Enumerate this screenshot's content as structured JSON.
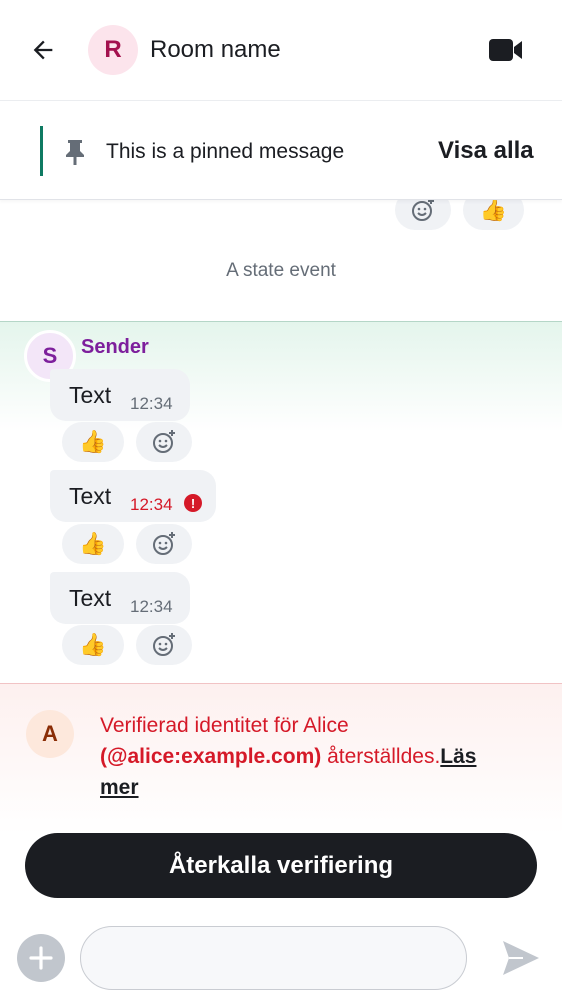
{
  "header": {
    "avatar_letter": "R",
    "room_name": "Room name"
  },
  "pinned": {
    "message": "This is a pinned message",
    "view_all": "Visa alla"
  },
  "top_reactions": [
    "👍"
  ],
  "state_event": "A state event",
  "group": {
    "avatar_letter": "S",
    "sender": "Sender",
    "messages": [
      {
        "text": "Text",
        "time": "12:34",
        "reaction": "👍",
        "failed": false
      },
      {
        "text": "Text",
        "time": "12:34",
        "reaction": "👍",
        "failed": true
      },
      {
        "text": "Text",
        "time": "12:34",
        "reaction": "👍",
        "failed": false
      }
    ]
  },
  "identity_reset": {
    "avatar_letter": "A",
    "text_prefix": "Verifierad identitet för Alice ",
    "user_id": "(@alice:example.com)",
    "text_suffix": " återställdes.",
    "read_more": "Läs mer",
    "withdraw_button": "Återkalla verifiering"
  },
  "composer": {
    "value": "",
    "placeholder": ""
  },
  "colors": {
    "accent_green": "#0e7a62",
    "error_red": "#d51928",
    "sender_purple": "#7d1f9c",
    "dark": "#1b1d22"
  }
}
